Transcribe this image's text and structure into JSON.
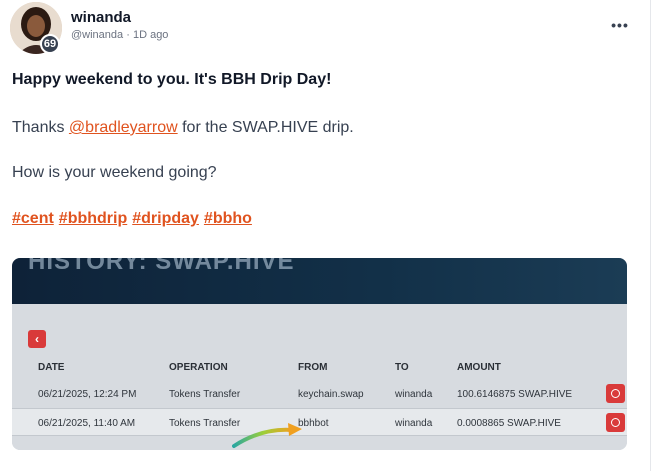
{
  "author": {
    "name": "winanda",
    "handle": "@winanda",
    "separator": "·",
    "time": "1D ago",
    "reputation": "69"
  },
  "menu": {
    "more_label": "•••"
  },
  "content": {
    "line1": "Happy weekend to you. It's BBH Drip Day!",
    "line2_prefix": "Thanks ",
    "mention": "@bradleyarrow",
    "line2_suffix": " for the SWAP.HIVE drip.",
    "line3": "How is your weekend going?",
    "tags": [
      "#cent",
      "#bbhdrip",
      "#dripday",
      "#bbho"
    ]
  },
  "screenshot": {
    "title": "HISTORY: SWAP.HIVE",
    "back_label": "‹",
    "columns": [
      "DATE",
      "OPERATION",
      "FROM",
      "TO",
      "AMOUNT"
    ],
    "rows": [
      [
        "06/21/2025, 12:24 PM",
        "Tokens Transfer",
        "keychain.swap",
        "winanda",
        "100.6146875 SWAP.HIVE"
      ],
      [
        "06/21/2025, 11:40 AM",
        "Tokens Transfer",
        "bbhbot",
        "winanda",
        "0.0008865 SWAP.HIVE"
      ]
    ],
    "colors": {
      "header": "#123048",
      "action": "#d93a3a",
      "accent": "#e0531f"
    }
  }
}
